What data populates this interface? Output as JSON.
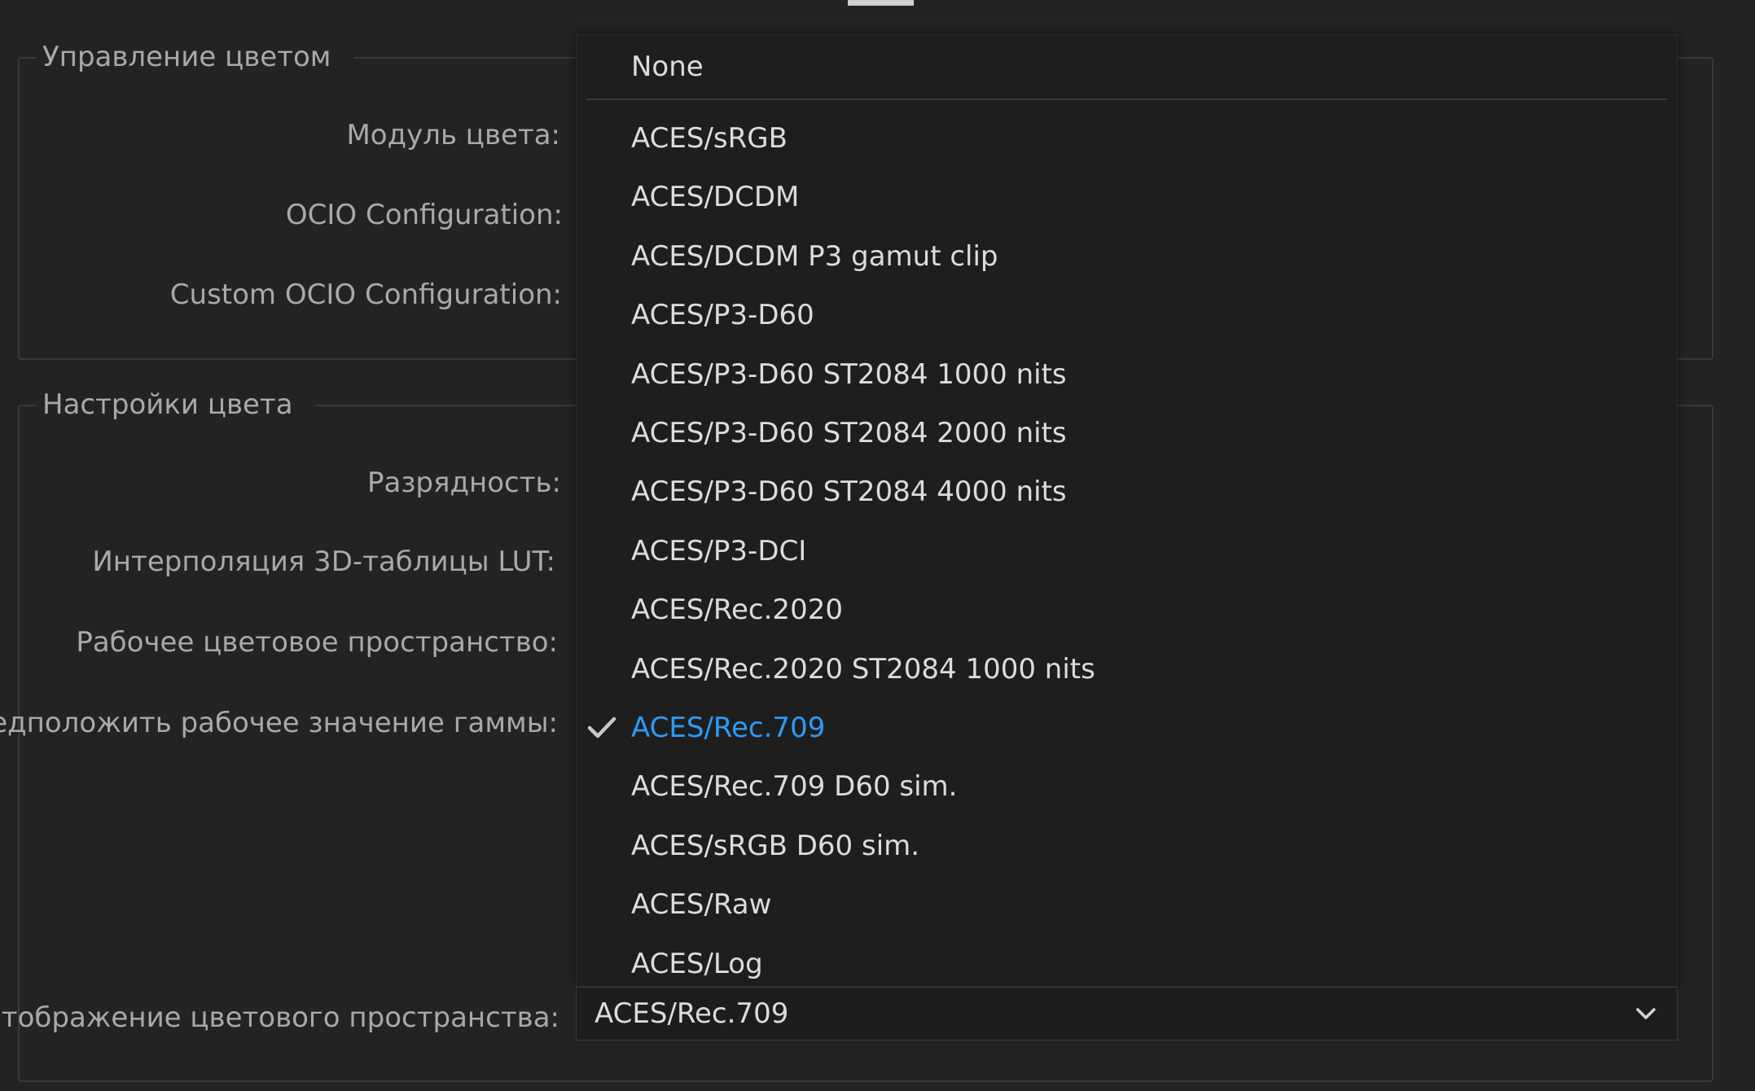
{
  "color_management": {
    "legend": "Управление цветом",
    "fields": [
      {
        "label": "Модуль цвета:"
      },
      {
        "label": "OCIO Configuration:"
      },
      {
        "label": "Custom OCIO Configuration:"
      }
    ]
  },
  "color_settings": {
    "legend": "Настройки цвета",
    "fields": [
      {
        "label": "Разрядность:"
      },
      {
        "label": "Интерполяция 3D-таблицы LUT:"
      },
      {
        "label": "Рабочее цветовое пространство:"
      },
      {
        "label": "Предположить рабочее значение гаммы:"
      },
      {
        "label": "Отображение цветового пространства:"
      }
    ]
  },
  "dropdown": {
    "items": [
      {
        "label": "None"
      },
      {
        "label": "ACES/sRGB"
      },
      {
        "label": "ACES/DCDM"
      },
      {
        "label": "ACES/DCDM P3 gamut clip"
      },
      {
        "label": "ACES/P3-D60"
      },
      {
        "label": "ACES/P3-D60 ST2084 1000 nits"
      },
      {
        "label": "ACES/P3-D60 ST2084 2000 nits"
      },
      {
        "label": "ACES/P3-D60 ST2084 4000 nits"
      },
      {
        "label": "ACES/P3-DCI"
      },
      {
        "label": "ACES/Rec.2020"
      },
      {
        "label": "ACES/Rec.2020 ST2084 1000 nits"
      },
      {
        "label": "ACES/Rec.709",
        "selected": true
      },
      {
        "label": "ACES/Rec.709 D60 sim."
      },
      {
        "label": "ACES/sRGB D60 sim."
      },
      {
        "label": "ACES/Raw"
      },
      {
        "label": "ACES/Log"
      }
    ],
    "selected_value": "ACES/Rec.709"
  },
  "icons": {
    "check": "checkmark-icon",
    "dropdown_arrow": "chevron-down-icon"
  },
  "colors": {
    "background": "#232323",
    "menu_background": "#1e1e1e",
    "label_text": "#a9a9a9",
    "item_text": "#dcdcdc",
    "accent": "#2e9bff"
  }
}
